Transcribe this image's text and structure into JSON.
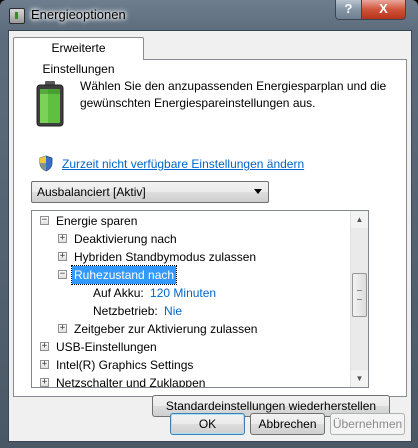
{
  "window": {
    "title": "Energieoptionen",
    "help_button": "?",
    "close_button": "X"
  },
  "tab": {
    "label": "Erweiterte Einstellungen"
  },
  "header": {
    "description": "Wählen Sie den anzupassenden Energiesparplan und die gewünschten Energiespareinstellungen aus.",
    "link": "Zurzeit nicht verfügbare Einstellungen ändern"
  },
  "plan_select": {
    "value": "Ausbalanciert [Aktiv]"
  },
  "tree": {
    "energy_saving": {
      "label": "Energie sparen",
      "expander": "−"
    },
    "deactivation": {
      "label": "Deaktivierung nach",
      "expander": "+"
    },
    "hybrid_standby": {
      "label": "Hybriden Standbymodus zulassen",
      "expander": "+"
    },
    "hibernate": {
      "label": "Ruhezustand nach",
      "expander": "−"
    },
    "on_battery": {
      "label": "Auf Akku:",
      "value": "120 Minuten"
    },
    "plugged_in": {
      "label": "Netzbetrieb:",
      "value": "Nie"
    },
    "wake_timers": {
      "label": "Zeitgeber zur Aktivierung zulassen",
      "expander": "+"
    },
    "usb": {
      "label": "USB-Einstellungen",
      "expander": "+"
    },
    "graphics": {
      "label": "Intel(R) Graphics Settings",
      "expander": "+"
    },
    "power_buttons": {
      "label": "Netzschalter und Zuklappen",
      "expander": "+"
    }
  },
  "scrollbar": {
    "position_fraction": 0.45
  },
  "buttons": {
    "restore": "Standardeinstellungen wiederherstellen",
    "ok": "OK",
    "cancel": "Abbrechen",
    "apply": "Übernehmen"
  },
  "colors": {
    "link": "#0066cc",
    "selection": "#3399ff",
    "close_button": "#d0533a"
  }
}
